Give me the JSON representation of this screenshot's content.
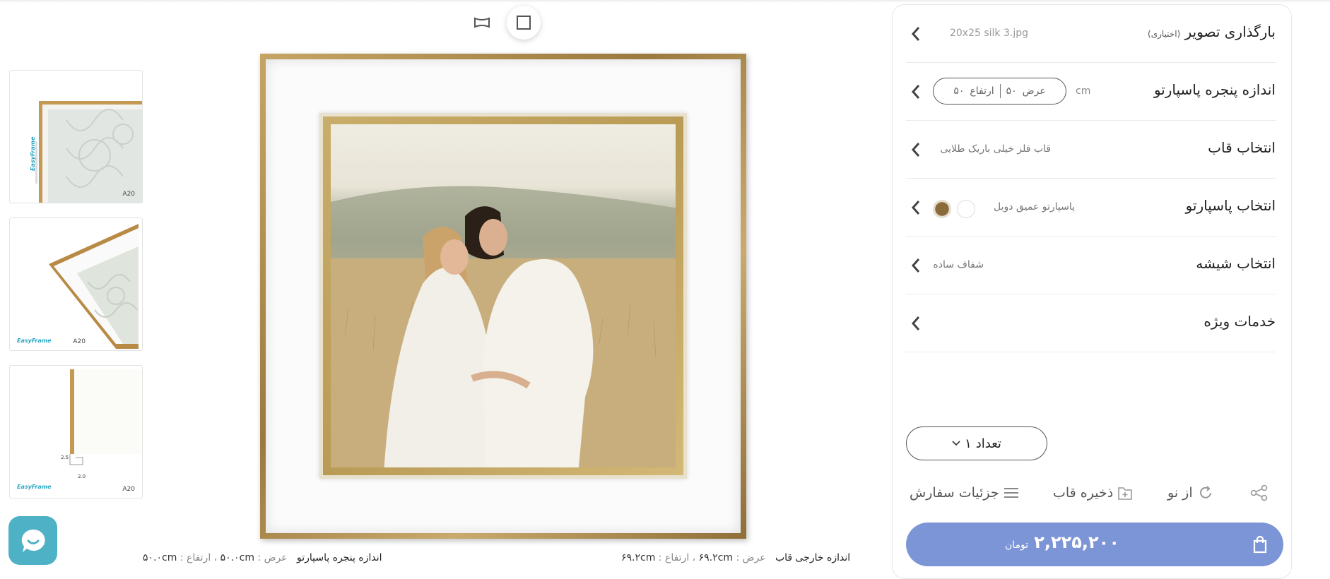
{
  "view_toggle": {
    "icons": [
      "panorama-icon",
      "square-icon"
    ],
    "active": "square"
  },
  "thumbnails": [
    {
      "tag": "A20",
      "logo": "EasyFrame"
    },
    {
      "tag": "A20",
      "logo": "EasyFrame"
    },
    {
      "tag": "A20",
      "logo": "EasyFrame",
      "dim_a": "2.5",
      "dim_b": "2.0"
    }
  ],
  "dimensions": {
    "outer": {
      "label": "اندازه خارجی قاب",
      "width_label": "عرض :",
      "width": "۶۹.۲cm",
      "height_label": "، ارتفاع :",
      "height": "۶۹.۲cm"
    },
    "window": {
      "label": "اندازه پنجره پاسپارتو",
      "width_label": "عرض :",
      "width": "۵۰.۰cm",
      "height_label": "، ارتفاع :",
      "height": "۵۰.۰cm"
    }
  },
  "panel": {
    "upload": {
      "title": "بارگذاری تصویر",
      "optional": "(اختیاری)",
      "file": "20x25 silk 3.jpg"
    },
    "window_size": {
      "title": "اندازه پنجره پاسپارتو",
      "unit": "cm",
      "width_label": "عرض",
      "width": "۵۰",
      "height_label": "ارتفاع",
      "height": "۵۰"
    },
    "frame": {
      "title": "انتخاب قاب",
      "value": "قاب فلز خیلی باریک طلایی"
    },
    "mat": {
      "title": "انتخاب پاسپارتو",
      "value": "پاسپارتو عمیق دوبل"
    },
    "glass": {
      "title": "انتخاب شیشه",
      "value": "شفاف ساده"
    },
    "services": {
      "title": "خدمات ویژه"
    },
    "quantity": {
      "label": "تعداد",
      "value": "۱"
    },
    "actions": {
      "details": "جزئیات سفارش",
      "save": "ذخیره قاب",
      "reset": "از نو"
    },
    "buy": {
      "price": "۲,۲۲۵,۲۰۰",
      "currency": "تومان"
    }
  },
  "colors": {
    "accent": "#7c95d6",
    "chat": "#4fb1c5",
    "frame_gold": "#b08d4c"
  }
}
